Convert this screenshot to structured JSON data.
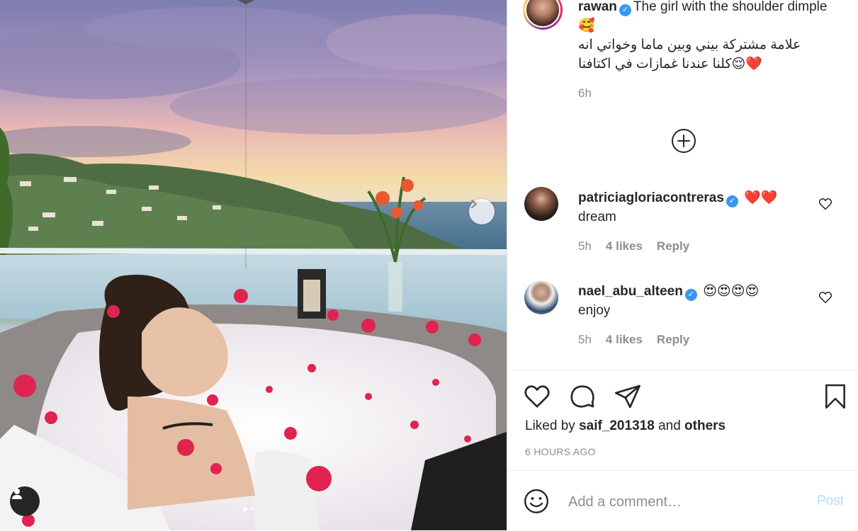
{
  "post": {
    "username": "rawan",
    "caption_en": "The girl with the shoulder dimple🥰",
    "caption_ar_1": "علامة مشتركة بيني وبين ماما وخواتي انه",
    "caption_ar_2": "❤️😌كلنا عندنا غمازات في اكتافنا",
    "time_ago": "6h",
    "liked_prefix": "Liked by",
    "liked_user": "saif_201318",
    "liked_and": "and",
    "liked_others": "others",
    "date": "6 HOURS AGO"
  },
  "comments": [
    {
      "username": "patriciagloriacontreras",
      "emoji": "❤️❤️",
      "text": "dream",
      "time": "5h",
      "likes": "4 likes",
      "reply": "Reply"
    },
    {
      "username": "nael_abu_alteen",
      "emoji": "😍😍😍😍",
      "text": "enjoy",
      "time": "5h",
      "likes": "4 likes",
      "reply": "Reply"
    }
  ],
  "composer": {
    "placeholder": "Add a comment…",
    "post_label": "Post"
  },
  "icons": {
    "like": "heart-icon",
    "comment": "comment-icon",
    "share": "paper-plane-icon",
    "save": "bookmark-icon",
    "emoji": "smiley-icon",
    "load_more": "plus-circle-icon",
    "next": "chevron-right-icon",
    "tags": "user-tag-icon"
  },
  "colors": {
    "verified": "#3897f0",
    "muted": "#8e8e8e",
    "post_disabled": "#b2dffc"
  },
  "carousel": {
    "current": 1,
    "total": 2
  }
}
